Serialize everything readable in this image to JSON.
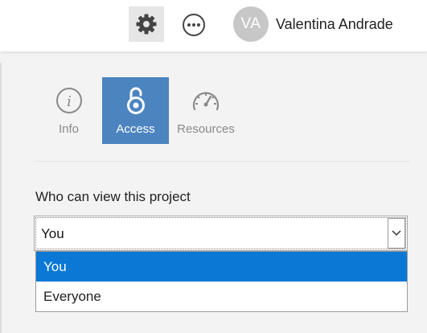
{
  "header": {
    "settings_icon": "gear-icon",
    "more_icon": "more-icon",
    "user": {
      "initials": "VA",
      "name": "Valentina Andrade"
    }
  },
  "tabs": [
    {
      "label": "Info",
      "icon": "info-icon",
      "active": false
    },
    {
      "label": "Access",
      "icon": "lock-icon",
      "active": true
    },
    {
      "label": "Resources",
      "icon": "gauge-icon",
      "active": false
    }
  ],
  "access": {
    "field_label": "Who can view this project",
    "selected_value": "You",
    "options": [
      "You",
      "Everyone"
    ],
    "highlighted_option": "You"
  },
  "colors": {
    "active_tab": "#4c84c0",
    "highlight": "#0a78d4"
  }
}
